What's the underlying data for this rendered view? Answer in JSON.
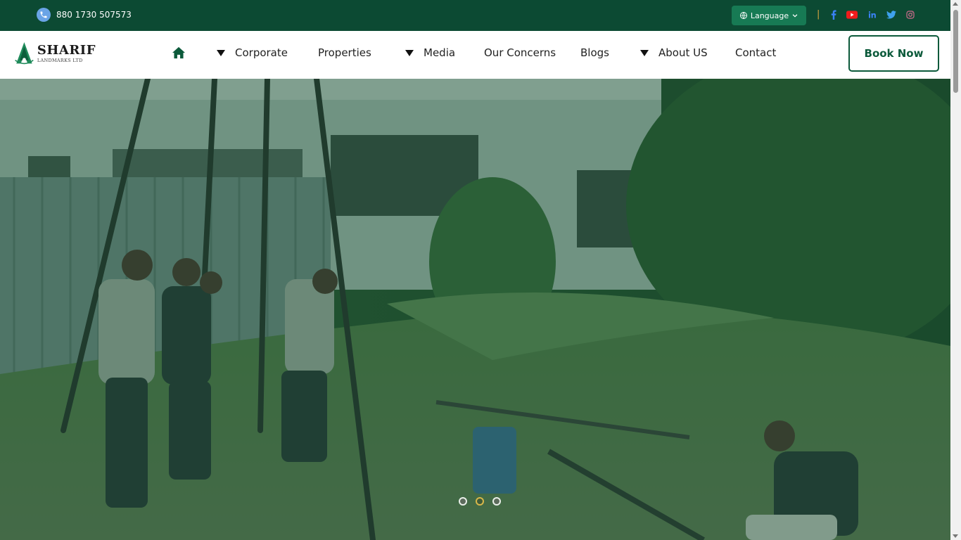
{
  "topbar": {
    "phone": "880 1730 507573",
    "language_label": "Language",
    "social": [
      {
        "icon": "facebook-icon",
        "color": "#3b82f6"
      },
      {
        "icon": "youtube-icon",
        "color": "#ef1c1c"
      },
      {
        "icon": "linkedin-icon",
        "color": "#3b82f6"
      },
      {
        "icon": "twitter-icon",
        "color": "#3ea1ec"
      },
      {
        "icon": "instagram-icon",
        "color": "#d36b8f"
      }
    ]
  },
  "logo": {
    "name": "SHARIF",
    "subtitle": "LANDMARKS LTD"
  },
  "nav": {
    "items": [
      {
        "label": "Corporate",
        "dropdown": true
      },
      {
        "label": "Properties",
        "dropdown": false
      },
      {
        "label": "Media",
        "dropdown": true
      },
      {
        "label": "Our Concerns",
        "dropdown": false
      },
      {
        "label": "Blogs",
        "dropdown": false
      },
      {
        "label": "About US",
        "dropdown": true
      },
      {
        "label": "Contact",
        "dropdown": false
      }
    ],
    "book_now": "Book Now"
  },
  "hero": {
    "slide_count": 3,
    "active_slide": 2
  },
  "colors": {
    "brand_dark": "#0c4a33",
    "brand": "#0c5a3b",
    "accent": "#d9a640"
  }
}
